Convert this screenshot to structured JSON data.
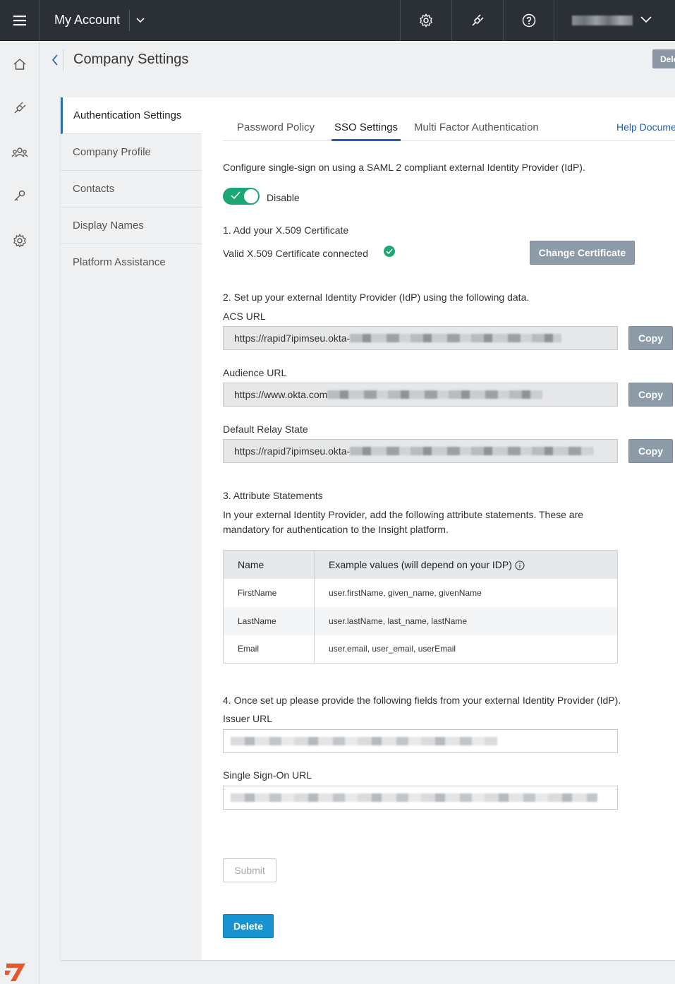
{
  "topbar": {
    "app_title": "My Account",
    "icons": [
      "menu-icon",
      "settings-icon",
      "plug-icon",
      "help-icon",
      "chevron-down-icon"
    ]
  },
  "rail": {
    "icons": [
      "home-icon",
      "plug-icon",
      "users-icon",
      "key-icon",
      "settings-icon"
    ]
  },
  "header": {
    "title": "Company Settings",
    "right_button": "Dele"
  },
  "side_menu": {
    "items": [
      {
        "label": "Authentication Settings"
      },
      {
        "label": "Company Profile"
      },
      {
        "label": "Contacts"
      },
      {
        "label": "Display Names"
      },
      {
        "label": "Platform Assistance"
      }
    ]
  },
  "tabs": {
    "items": [
      {
        "label": "Password Policy"
      },
      {
        "label": "SSO Settings"
      },
      {
        "label": "Multi Factor Authentication"
      }
    ],
    "help_link": "Help Docume"
  },
  "sso": {
    "intro": "Configure single-sign on using a SAML 2 compliant external Identity Provider (IdP).",
    "toggle_label": "Disable",
    "step1": "1. Add your X.509 Certificate",
    "cert_status": "Valid X.509 Certificate connected",
    "change_cert_button": "Change Certificate",
    "step2": "2. Set up your external Identity Provider (IdP) using the following data.",
    "acs_label": "ACS URL",
    "acs_value": "https://rapid7ipimseu.okta-",
    "audience_label": "Audience URL",
    "audience_value": "https://www.okta.com",
    "relay_label": "Default Relay State",
    "relay_value": "https://rapid7ipimseu.okta-",
    "copy_button": "Copy",
    "step3": "3. Attribute Statements",
    "step3_desc_line1": "In your external Identity Provider, add the following attribute statements. These are",
    "step3_desc_line2": "mandatory for authentication to the Insight platform.",
    "table": {
      "headers": [
        "Name",
        "Example values (will depend on your IDP)"
      ],
      "rows": [
        [
          "FirstName",
          "user.firstName, given_name, givenName"
        ],
        [
          "LastName",
          "user.lastName, last_name, lastName"
        ],
        [
          "Email",
          "user.email, user_email, userEmail"
        ]
      ]
    },
    "step4": "4. Once set up please provide the following fields from your external Identity Provider (IdP).",
    "issuer_label": "Issuer URL",
    "sso_url_label": "Single Sign-On URL",
    "submit_button": "Submit",
    "delete_button": "Delete"
  },
  "colors": {
    "topbar": "#2b3036",
    "accent": "#1f5ea8",
    "toggle_on": "#1aa774",
    "delete": "#1793d1",
    "logo": "#e8562a"
  }
}
